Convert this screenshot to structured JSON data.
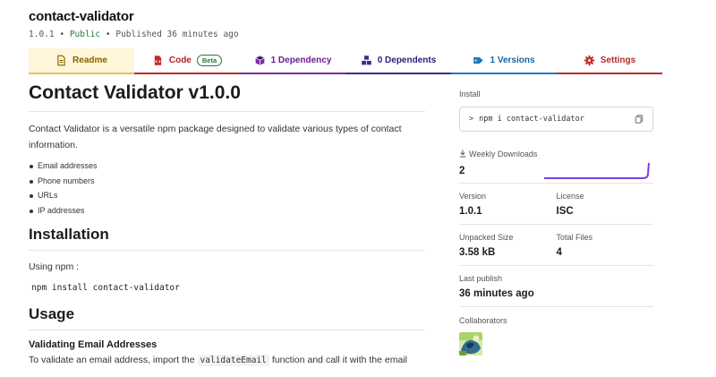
{
  "package": {
    "name": "contact-validator",
    "version": "1.0.1",
    "visibility": "Public",
    "published": "Published 36 minutes ago",
    "separator": "•"
  },
  "tabs": [
    {
      "label": "Readme",
      "icon": "document-icon",
      "color": "#8a6100"
    },
    {
      "label": "Code",
      "badge": "Beta",
      "icon": "code-file-icon",
      "color": "#b72323"
    },
    {
      "label": "1 Dependency",
      "icon": "box-icon",
      "color": "#6a1b9a"
    },
    {
      "label": "0 Dependents",
      "icon": "cubes-icon",
      "color": "#2e1c7a"
    },
    {
      "label": "1 Versions",
      "icon": "tag-icon",
      "color": "#1565a6"
    },
    {
      "label": "Settings",
      "icon": "gear-icon",
      "color": "#b22b2b"
    }
  ],
  "readme": {
    "title": "Contact Validator v1.0.0",
    "intro": "Contact Validator is a versatile npm package designed to validate various types of contact information.",
    "features": [
      "Email addresses",
      "Phone numbers",
      "URLs",
      "IP addresses"
    ],
    "installation_heading": "Installation",
    "using_npm": "Using npm :",
    "install_cmd": "npm install contact-validator",
    "usage_heading": "Usage",
    "email_heading": "Validating Email Addresses",
    "email_text_before": "To validate an email address, import the",
    "email_func": "validateEmail",
    "email_text_after": "function and call it with the email"
  },
  "sidebar": {
    "install_label": "Install",
    "install_prompt": ">",
    "install_cmd": "npm i contact-validator",
    "downloads_label": "Weekly Downloads",
    "downloads_value": "2",
    "version_label": "Version",
    "version_value": "1.0.1",
    "license_label": "License",
    "license_value": "ISC",
    "unpacked_label": "Unpacked Size",
    "unpacked_value": "3.58 kB",
    "files_label": "Total Files",
    "files_value": "4",
    "publish_label": "Last publish",
    "publish_value": "36 minutes ago",
    "collab_label": "Collaborators"
  },
  "colors": {
    "readme_tab_bg": "#fff6d9",
    "sparkline": "#7b3fe4",
    "public": "#1f7a3c"
  }
}
